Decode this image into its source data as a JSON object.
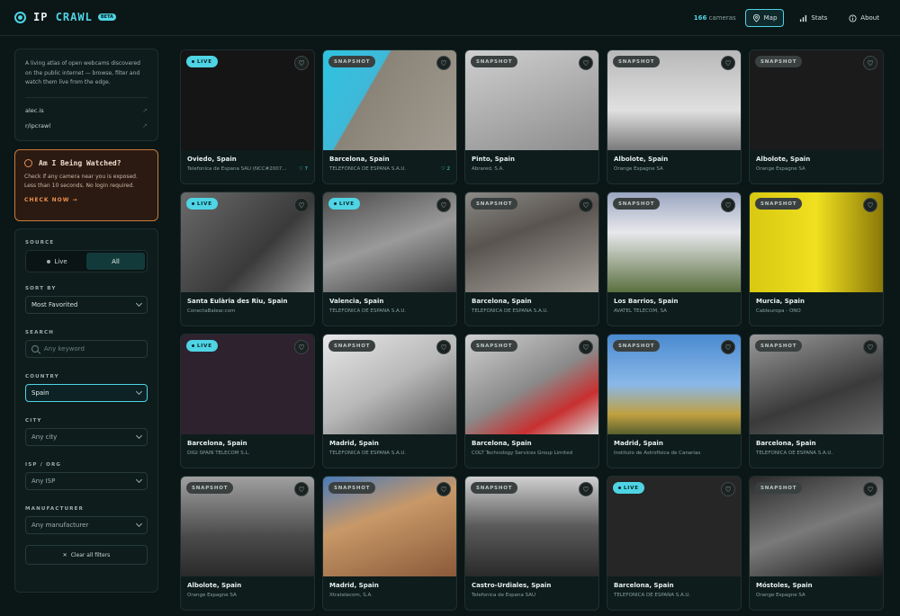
{
  "header": {
    "logo_a": "IP",
    "logo_b": "CRAWL",
    "beta": "BETA",
    "camera_count": "166",
    "camera_count_label": "cameras",
    "nav": [
      {
        "label": "Map"
      },
      {
        "label": "Stats"
      },
      {
        "label": "About"
      }
    ]
  },
  "intro": {
    "text": "A living atlas of open webcams discovered on the public internet — browse, filter and watch them live from the edge.",
    "links": [
      {
        "label": "alec.is"
      },
      {
        "label": "r/ipcrawl"
      }
    ]
  },
  "watch": {
    "title": "Am I Being Watched?",
    "desc": "Check if any camera near you is exposed. Less than 10 seconds. No login required.",
    "cta": "CHECK NOW →"
  },
  "filters": {
    "source_label": "SOURCE",
    "source_options": [
      "Live",
      "All"
    ],
    "sort_label": "SORT BY",
    "sort_value": "Most Favorited",
    "search_label": "SEARCH",
    "search_placeholder": "Any keyword",
    "country_label": "COUNTRY",
    "country_value": "Spain",
    "city_label": "CITY",
    "city_value": "Any city",
    "isp_label": "ISP / ORG",
    "isp_value": "Any ISP",
    "manufacturer_label": "MANUFACTURER",
    "manufacturer_value": "Any manufacturer",
    "clear_label": "Clear all filters"
  },
  "colors": {
    "accent": "#4fd4e4",
    "background": "#0b1616",
    "watch_accent": "#f0904a"
  },
  "cameras": [
    {
      "status": "LIVE",
      "city": "Oviedo, Spain",
      "isp": "Telefonica de Espana SAU (NCC#2007...",
      "favs": "♡ 7",
      "thumb": "#151515"
    },
    {
      "status": "SNAPSHOT",
      "city": "Barcelona, Spain",
      "isp": "TELEFONICA DE ESPANA S.A.U.",
      "favs": "♡ 2",
      "thumb": "linear-gradient(120deg,#2ec4e0 0%,#3fb8d8 35%,#8a8478 36%,#a09a90 100%)"
    },
    {
      "status": "SNAPSHOT",
      "city": "Pinto, Spain",
      "isp": "Abrared, S.A.",
      "favs": "",
      "thumb": "linear-gradient(160deg,#cfcfcf,#8d8d8d)"
    },
    {
      "status": "SNAPSHOT",
      "city": "Albolote, Spain",
      "isp": "Orange Espagne SA",
      "favs": "",
      "thumb": "linear-gradient(180deg,#b8b8b8,#e0e0e0 60%,#7a7a7a)"
    },
    {
      "status": "SNAPSHOT",
      "city": "Albolote, Spain",
      "isp": "Orange Espagne SA",
      "favs": "",
      "thumb": "#1b1b1b"
    },
    {
      "status": "LIVE",
      "city": "Santa Eulària des Riu, Spain",
      "isp": "ConectaBalear.com",
      "favs": "",
      "thumb": "linear-gradient(135deg,#6a6a6a,#3a3a3a 60%,#9a9a9a)"
    },
    {
      "status": "LIVE",
      "city": "Valencia, Spain",
      "isp": "TELEFONICA DE ESPANA S.A.U.",
      "favs": "",
      "thumb": "linear-gradient(160deg,#4a4a4a,#9a9a9a 50%,#3a3a3a)"
    },
    {
      "status": "SNAPSHOT",
      "city": "Barcelona, Spain",
      "isp": "TELEFONICA DE ESPANA S.A.U.",
      "favs": "",
      "thumb": "linear-gradient(160deg,#8a8a86,#5a5450 40%,#a8a49c)"
    },
    {
      "status": "SNAPSHOT",
      "city": "Los Barrios, Spain",
      "isp": "AVATEL TELECOM, SA",
      "favs": "",
      "thumb": "linear-gradient(180deg,#9aa6c0,#e8e8ec 40%,#5a7040)"
    },
    {
      "status": "SNAPSHOT",
      "city": "Murcia, Spain",
      "isp": "Cableuropa - ONO",
      "favs": "",
      "thumb": "linear-gradient(90deg,#d8c810,#f0e020 50%,#8a7808)"
    },
    {
      "status": "LIVE",
      "city": "Barcelona, Spain",
      "isp": "DIGI SPAIN TELECOM S.L.",
      "favs": "",
      "thumb": "#2e222e"
    },
    {
      "status": "SNAPSHOT",
      "city": "Madrid, Spain",
      "isp": "TELEFONICA DE ESPANA S.A.U.",
      "favs": "",
      "thumb": "linear-gradient(150deg,#e8e8e8,#b8b8b8 50%,#5a5a5a)"
    },
    {
      "status": "SNAPSHOT",
      "city": "Barcelona, Spain",
      "isp": "COLT Technology Services Group Limited",
      "favs": "",
      "thumb": "linear-gradient(150deg,#d0d0d0,#8a8a8a 50%,#c83030 75%,#d8d8d8)"
    },
    {
      "status": "SNAPSHOT",
      "city": "Madrid, Spain",
      "isp": "Instituto de Astrofisica de Canarias",
      "favs": "",
      "thumb": "linear-gradient(180deg,#4a8ad0,#8ab8e8 50%,#c0a040 80%,#5a6030)"
    },
    {
      "status": "SNAPSHOT",
      "city": "Barcelona, Spain",
      "isp": "TELEFONICA DE ESPANA S.A.U.",
      "favs": "",
      "thumb": "linear-gradient(160deg,#9a9a9a,#3a3a3a 60%,#6a6a6a)"
    },
    {
      "status": "SNAPSHOT",
      "city": "Albolote, Spain",
      "isp": "Orange Espagne SA",
      "favs": "",
      "thumb": "linear-gradient(180deg,#a0a0a0,#4a4a4a 60%,#2a2a2a)"
    },
    {
      "status": "SNAPSHOT",
      "city": "Madrid, Spain",
      "isp": "Xtratelecom, S.A.",
      "favs": "",
      "thumb": "linear-gradient(160deg,#4a7ab8,#c89868 40%,#8a5a3a)"
    },
    {
      "status": "SNAPSHOT",
      "city": "Castro-Urdiales, Spain",
      "isp": "Telefonica de Espana SAU",
      "favs": "",
      "thumb": "linear-gradient(180deg,#d0d0d0,#5a5a5a 50%,#2a2a2a)"
    },
    {
      "status": "LIVE",
      "city": "Barcelona, Spain",
      "isp": "TELEFONICA DE ESPANA S.A.U.",
      "favs": "",
      "thumb": "#262626"
    },
    {
      "status": "SNAPSHOT",
      "city": "Móstoles, Spain",
      "isp": "Orange Espagne SA",
      "favs": "",
      "thumb": "linear-gradient(160deg,#2a2a2a,#7a7a7a 50%,#1a1a1a)"
    }
  ]
}
